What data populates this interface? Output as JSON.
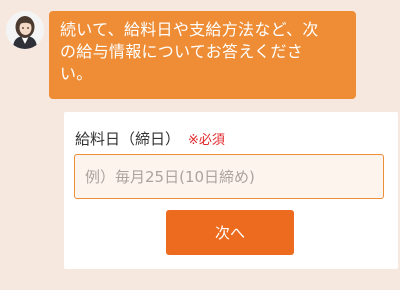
{
  "chat": {
    "avatar_icon": "operator-avatar-icon",
    "message": "続いて、給料日や支給方法など、次\nの給与情報についてお答えくださ\nい。",
    "bubble_color": "#ee8d36"
  },
  "form": {
    "payday_label": "給料日（締日）",
    "required_text": "※必須",
    "payday_placeholder": "例）毎月25日(10日締め)",
    "payday_value": "",
    "next_label": "次へ",
    "accent_color": "#ec6b1f",
    "required_color": "#e1282d"
  }
}
